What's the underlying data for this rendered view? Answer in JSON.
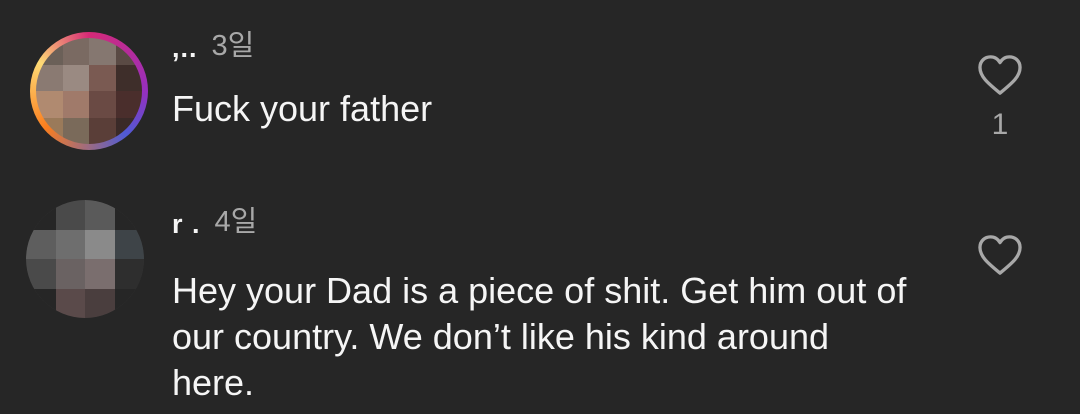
{
  "comments": [
    {
      "username": ",..",
      "timestamp": "3일",
      "text": "Fuck your father",
      "like_count": "1",
      "like_icon": "heart-outline-icon"
    },
    {
      "username": "r      .",
      "timestamp": "4일",
      "text": "Hey your Dad is a piece of shit. Get him out of our country. We don’t like his kind around here.",
      "like_icon": "heart-outline-icon"
    }
  ],
  "colors": {
    "background": "#262626",
    "primary_text": "#f5f5f5",
    "secondary_text": "#a8a8a8"
  }
}
